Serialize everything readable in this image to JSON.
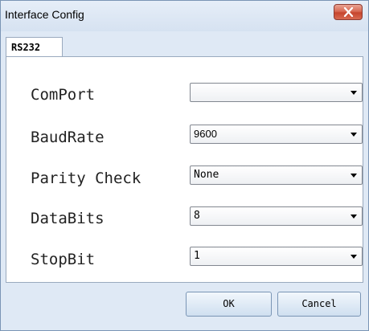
{
  "window": {
    "title": "Interface Config",
    "close_icon": "close-icon"
  },
  "tabs": [
    {
      "label": "RS232",
      "active": true
    }
  ],
  "settings": [
    {
      "label": "ComPort",
      "value": ""
    },
    {
      "label": "BaudRate",
      "value": "9600"
    },
    {
      "label": "Parity Check",
      "value": "None"
    },
    {
      "label": "DataBits",
      "value": "8"
    },
    {
      "label": "StopBit",
      "value": "1"
    }
  ],
  "buttons": {
    "ok_label": "OK",
    "cancel_label": "Cancel"
  },
  "colors": {
    "close_button": "#c6452d",
    "chrome_background": "#dfe9f5"
  }
}
